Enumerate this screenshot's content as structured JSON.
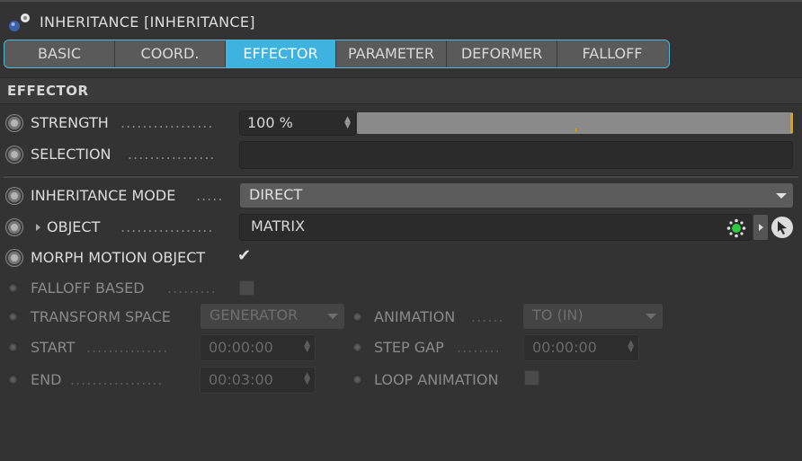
{
  "header": {
    "title": "INHERITANCE [INHERITANCE]",
    "icon": "inheritance-object-icon"
  },
  "tabs": [
    {
      "label": "BASIC",
      "active": false
    },
    {
      "label": "COORD.",
      "active": false
    },
    {
      "label": "EFFECTOR",
      "active": true
    },
    {
      "label": "PARAMETER",
      "active": false
    },
    {
      "label": "DEFORMER",
      "active": false
    },
    {
      "label": "FALLOFF",
      "active": false
    }
  ],
  "colors": {
    "active_tab": "#3fb3e0",
    "tab_border": "#55b6d6",
    "slider_marker": "#e2a100",
    "background": "#333333"
  },
  "section": {
    "title": "EFFECTOR"
  },
  "strength": {
    "label": "STRENGTH",
    "value": "100 %",
    "slider_fraction": 1.0
  },
  "selection": {
    "label": "SELECTION",
    "value": ""
  },
  "inheritance_mode": {
    "label": "INHERITANCE MODE",
    "value": "DIRECT"
  },
  "object": {
    "label": "OBJECT",
    "value": "MATRIX",
    "icons": [
      "matrix-icon",
      "arrow-right-icon",
      "pick-cursor-icon"
    ]
  },
  "morph_motion": {
    "label": "MORPH MOTION OBJECT",
    "checked": true
  },
  "falloff_based": {
    "label": "FALLOFF BASED",
    "checked": false
  },
  "transform_space": {
    "label": "TRANSFORM SPACE",
    "value": "GENERATOR"
  },
  "animation": {
    "label": "ANIMATION",
    "value": "TO (IN)"
  },
  "start": {
    "label": "START",
    "value": "00:00:00"
  },
  "step_gap": {
    "label": "STEP GAP",
    "value": "00:00:00"
  },
  "end": {
    "label": "END",
    "value": "00:03:00"
  },
  "loop_animation": {
    "label": "LOOP ANIMATION",
    "checked": false
  }
}
